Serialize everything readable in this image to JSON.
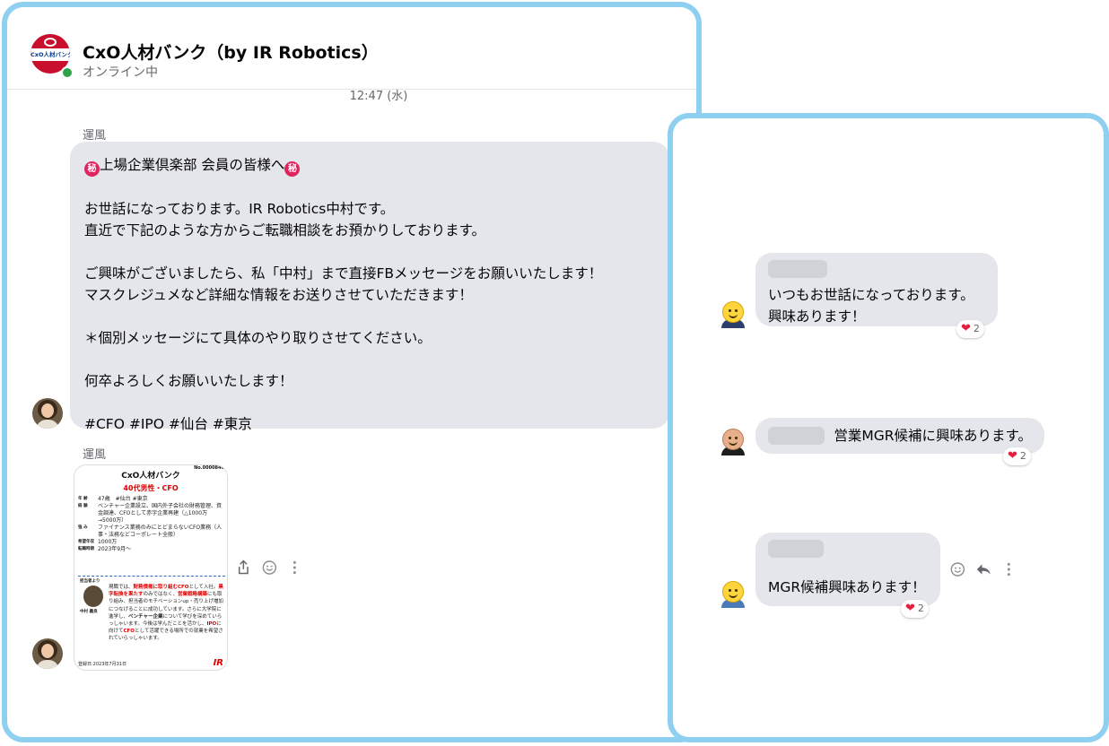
{
  "header": {
    "title": "CxO人材バンク（by IR Robotics）",
    "status": "オンライン中",
    "logo_text": "CxO人材バンク"
  },
  "timestamp": "12:47 (水)",
  "sender_1": "運風",
  "sender_2": "運風",
  "message": {
    "lines": [
      "上場企業倶楽部 会員の皆様へ",
      "",
      "お世話になっております。IR Robotics中村です。",
      "直近で下記のような方からご転職相談をお預かりしております。",
      "",
      "ご興味がございましたら、私「中村」まで直接FBメッセージをお願いいたします！",
      "マスクレジュメなど詳細な情報をお送りさせていただきます！",
      "",
      "＊個別メッセージにて具体のやり取りさせてください。",
      "",
      "何卒よろしくお願いいたします！",
      "",
      "#CFO #IPO #仙台 #東京"
    ],
    "secret_mark": "秘"
  },
  "card": {
    "title": "CxO人材バンク",
    "number": "No.0000846",
    "headline": "40代男性・CFO",
    "rows": [
      {
        "k": "年 齢",
        "v": "47歳　#仙台 #東京"
      },
      {
        "k": "経 験",
        "v": "ベンチャー企業設立、国内外子会社の財務管理、資金調達、CFOとして赤字企業再建（△1000万→5000万）"
      },
      {
        "k": "強 み",
        "v": "ファイナンス業務のみにとどまらないCFO業務（人事・法務などコーポレート全般）"
      },
      {
        "k": "希望年収",
        "v": "1000万"
      },
      {
        "k": "転職時期",
        "v": "2023年9月～"
      }
    ],
    "reco_label": "担当者より",
    "reco_name": "中村 義良",
    "reco_text_1": "現職では、",
    "reco_red_1": "財務債権に取り組むCFO",
    "reco_text_2": "として入社。",
    "reco_red_2": "黒字転換を果たす",
    "reco_text_3": "のみではなく、",
    "reco_red_3": "営業戦略構築",
    "reco_text_4": "にも取り組み、担当者のモチベーションup・売り上げ増加につなげることに成功しています。さらに大学院に進学し、",
    "reco_bold": "ベンチャー企業",
    "reco_text_5": "について学びを深めていらっしゃいます。今後は学んだことを活かし、",
    "reco_red_4": "IPO",
    "reco_text_6": "に向けて",
    "reco_red_5": "CFO",
    "reco_text_7": "として活躍できる場所での就業を希望されていらっしゃいます。",
    "date": "登録日:2023年7月31日",
    "brand": "IR"
  },
  "replies": [
    {
      "lines": [
        "いつもお世話になっております。",
        "興味あります！"
      ],
      "reaction_count": "2"
    },
    {
      "lines": [
        "営業MGR候補に興味あります。"
      ],
      "reaction_count": "2"
    },
    {
      "lines": [
        "MGR候補興味あります！"
      ],
      "reaction_count": "2"
    }
  ],
  "colors": {
    "panel_border": "#8fd0f1",
    "bubble": "#e4e6eb",
    "online": "#31a24c",
    "heart": "#e41e3f"
  },
  "icons": {
    "share": "share-icon",
    "emoji": "emoji-icon",
    "more": "more-icon",
    "reply": "reply-icon"
  }
}
